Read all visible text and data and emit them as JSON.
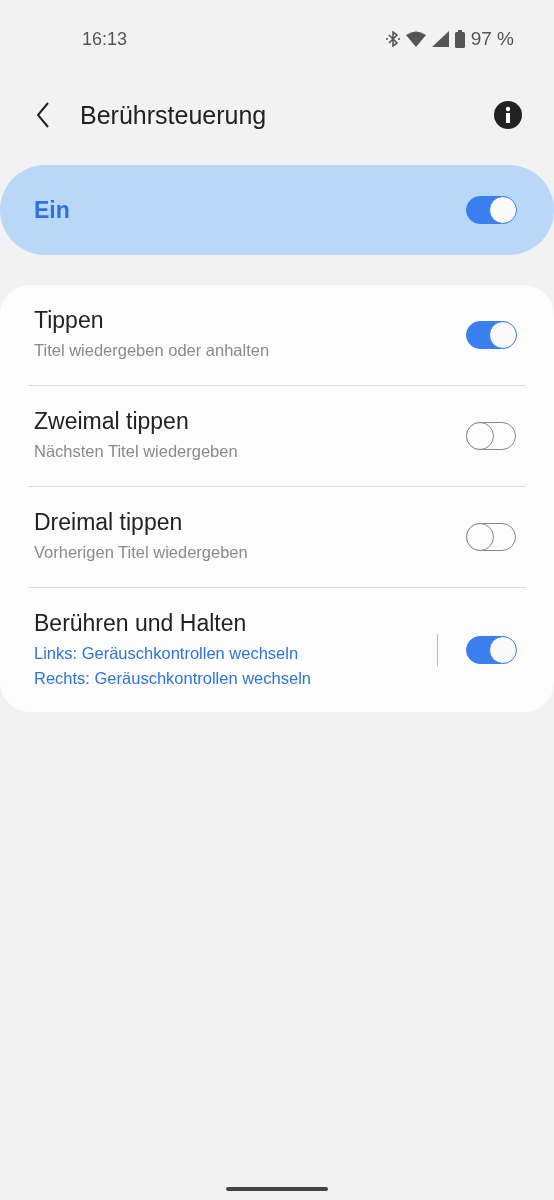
{
  "status_bar": {
    "time": "16:13",
    "battery": "97 %"
  },
  "header": {
    "title": "Berührsteuerung"
  },
  "master": {
    "label": "Ein",
    "on": true
  },
  "items": [
    {
      "kind": "plain",
      "title": "Tippen",
      "subtitles": [
        "Titel wiedergeben oder anhalten"
      ],
      "on": true
    },
    {
      "kind": "plain",
      "title": "Zweimal tippen",
      "subtitles": [
        "Nächsten Titel wiedergeben"
      ],
      "on": false
    },
    {
      "kind": "plain",
      "title": "Dreimal tippen",
      "subtitles": [
        "Vorherigen Titel wiedergeben"
      ],
      "on": false
    },
    {
      "kind": "detail",
      "title": "Berühren und Halten",
      "subtitles": [
        "Links: Geräuschkontrollen wechseln",
        "Rechts: Geräuschkontrollen wechseln"
      ],
      "on": true
    }
  ]
}
